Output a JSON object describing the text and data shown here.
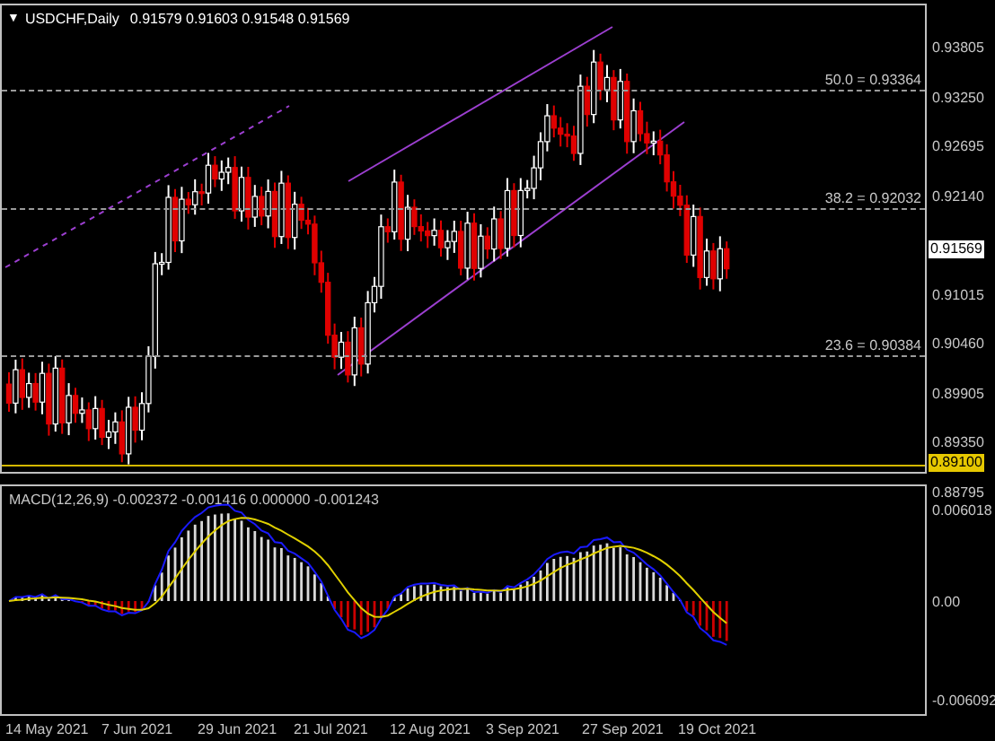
{
  "chart": {
    "collapse_arrow": "▼",
    "title": "USDCHF,Daily",
    "ohlc": [
      "0.91579",
      "0.91603",
      "0.91548",
      "0.91569"
    ],
    "fib_levels": [
      "50.0 = 0.93364",
      "38.2 = 0.92032",
      "23.6 = 0.90384"
    ],
    "price_ticks": [
      "0.93805",
      "0.93250",
      "0.92695",
      "0.92140",
      "0.91015",
      "0.90460",
      "0.89905",
      "0.89350",
      "0.88795"
    ],
    "current_price": "0.91569",
    "level_line": "0.89100"
  },
  "macd": {
    "label": "MACD(12,26,9) -0.002372 -0.001416 0.000000 -0.001243",
    "ticks": [
      "0.006018",
      "0.00",
      "-0.006092"
    ]
  },
  "dates": [
    "14 May 2021",
    "7 Jun 2021",
    "29 Jun 2021",
    "21 Jul 2021",
    "12 Aug 2021",
    "3 Sep 2021",
    "27 Sep 2021",
    "19 Oct 2021"
  ]
}
